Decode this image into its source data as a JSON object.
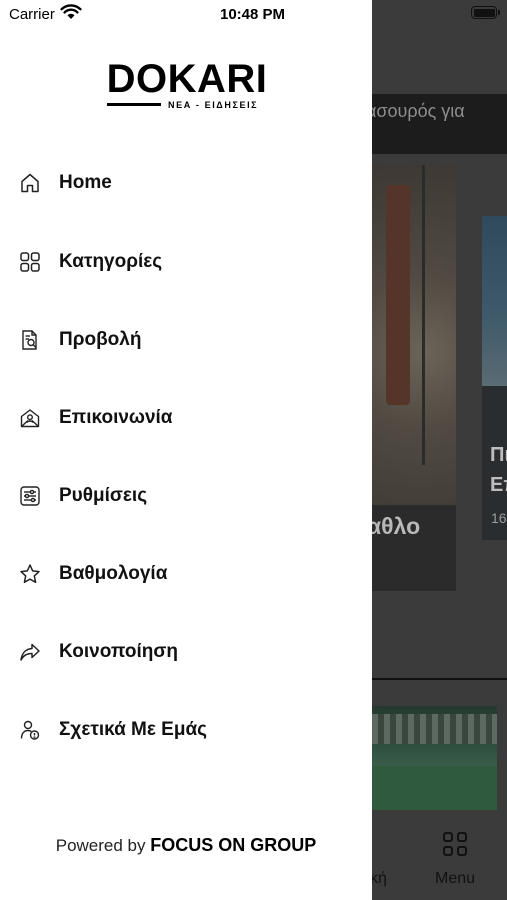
{
  "status_bar": {
    "carrier": "Carrier",
    "time": "10:48 PM"
  },
  "drawer": {
    "logo": {
      "title": "DOKARI",
      "subtitle": "ΝΕΑ - ΕΙΔΗΣΕΙΣ"
    },
    "items": [
      {
        "label": "Home",
        "icon": "home-icon"
      },
      {
        "label": "Κατηγορίες",
        "icon": "grid-icon"
      },
      {
        "label": "Προβολή",
        "icon": "document-search-icon"
      },
      {
        "label": "Επικοινωνία",
        "icon": "mail-contact-icon"
      },
      {
        "label": "Ρυθμίσεις",
        "icon": "sliders-icon"
      },
      {
        "label": "Βαθμολογία",
        "icon": "star-icon"
      },
      {
        "label": "Κοινοποίηση",
        "icon": "share-icon"
      },
      {
        "label": "Σχετικά Με Εμάς",
        "icon": "about-user-icon"
      }
    ],
    "footer": {
      "prefix": "Powered by",
      "brand": "FOCUS ON GROUP"
    }
  },
  "background": {
    "headline_partial": "ασουρός για",
    "card1_title_partial": "αθλο",
    "card2_title_line1": "Πι",
    "card2_title_line2": "Επ",
    "card2_date_partial": "16",
    "tabbar_partial_label": "κή",
    "tabbar_menu_label": "Menu"
  },
  "colors": {
    "overlay": "#3b3b3b",
    "drawer_bg": "#ffffff",
    "text": "#111111"
  }
}
